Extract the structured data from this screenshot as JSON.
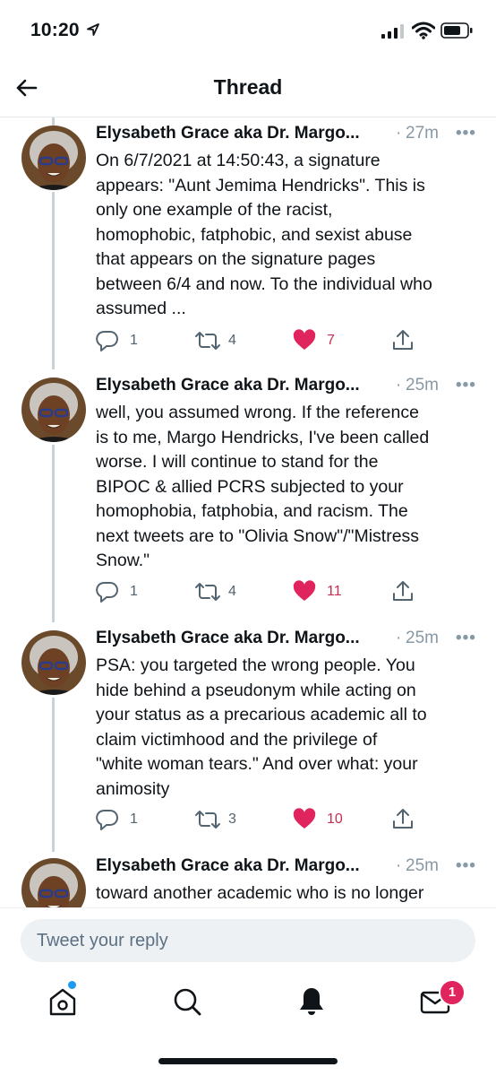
{
  "status_bar": {
    "time": "10:20"
  },
  "header": {
    "title": "Thread"
  },
  "tweets": [
    {
      "author": "Elysabeth Grace aka Dr. Margo...",
      "separator": "·",
      "time_ago": "27m",
      "text": "On 6/7/2021 at 14:50:43, a signature\nappears: \"Aunt Jemima Hendricks\". This is\nonly one example of the racist,\nhomophobic, fatphobic, and sexist abuse\nthat appears on the signature pages\nbetween 6/4 and now. To the individual who\nassumed ...",
      "replies": "1",
      "retweets": "4",
      "likes": "7"
    },
    {
      "author": "Elysabeth Grace aka Dr. Margo...",
      "separator": "·",
      "time_ago": "25m",
      "text": "well, you assumed wrong. If the reference\nis to me, Margo Hendricks, I've been called\nworse. I will continue to stand for the\nBIPOC & allied PCRS subjected to your\nhomophobia, fatphobia, and racism. The\nnext tweets are to \"Olivia Snow\"/\"Mistress\nSnow.\"",
      "replies": "1",
      "retweets": "4",
      "likes": "11"
    },
    {
      "author": "Elysabeth Grace aka Dr. Margo...",
      "separator": "·",
      "time_ago": "25m",
      "text": "PSA: you targeted the wrong people. You\nhide behind a pseudonym while acting on\nyour status as a precarious academic all to\nclaim victimhood and the privilege of\n\"white woman tears.\" And over what: your\nanimosity",
      "replies": "1",
      "retweets": "3",
      "likes": "10"
    },
    {
      "author": "Elysabeth Grace aka Dr. Margo...",
      "separator": "·",
      "time_ago": "25m",
      "text": "toward another academic who is no longer"
    }
  ],
  "more_glyph": "•••",
  "reply_box": {
    "placeholder": "Tweet your reply"
  },
  "tab_bar": {
    "messages_badge": "1"
  },
  "colors": {
    "like": "#e0245e",
    "accent": "#1d9bf0",
    "muted": "#536471",
    "thread_line": "#c9d1d8"
  }
}
